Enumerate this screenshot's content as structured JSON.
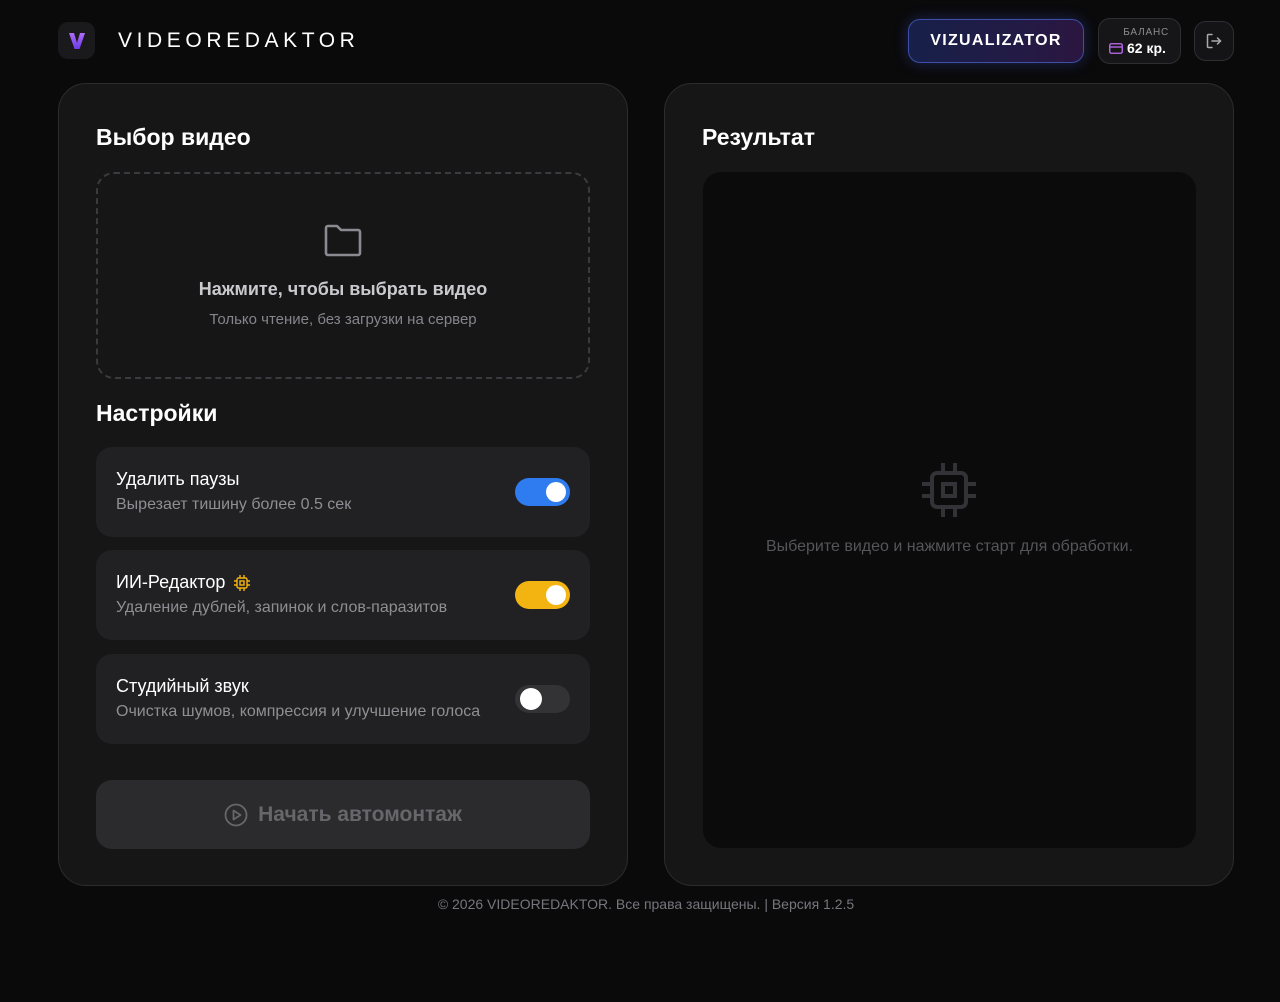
{
  "header": {
    "logo_letter": "V",
    "app_name": "VIDEOREDAKTOR",
    "vizualizator_label": "VIZUALIZATOR",
    "balance_label": "БАЛАНС",
    "balance_value": "62 кр."
  },
  "left_panel": {
    "title": "Выбор видео",
    "dropzone": {
      "icon": "folder-icon",
      "title": "Нажмите, чтобы выбрать видео",
      "subtitle": "Только чтение, без загрузки на сервер"
    },
    "settings_title": "Настройки",
    "settings": [
      {
        "name": "Удалить паузы",
        "description": "Вырезает тишину более 0.5 сек",
        "enabled": true,
        "color": "#2f7bf0"
      },
      {
        "name": "ИИ-Редактор",
        "description": "Удаление дублей, запинок и слов-паразитов",
        "enabled": true,
        "color": "#f3b311",
        "badge_icon": "chip-icon"
      },
      {
        "name": "Студийный звук",
        "description": "Очистка шумов, компрессия и улучшение голоса",
        "enabled": false,
        "color": "#333336"
      }
    ],
    "start_button": {
      "label": "Начать автомонтаж",
      "icon": "play-circle-icon",
      "disabled": true
    }
  },
  "right_panel": {
    "title": "Результат",
    "placeholder_icon": "chip-icon",
    "placeholder_text": "Выберите видео и нажмите старт для обработки."
  },
  "footer": {
    "text": "© 2026 VIDEOREDAKTOR. Все права защищены. | Версия 1.2.5"
  },
  "colors": {
    "background": "#0a0a0b",
    "panel": "#161617",
    "accent_blue": "#2f7bf0",
    "accent_amber": "#f3b311",
    "logo_purple": "#8b5cf6"
  }
}
